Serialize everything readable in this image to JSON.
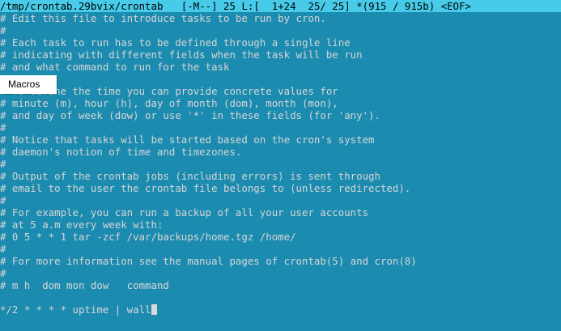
{
  "status_bar": {
    "file_path": "/tmp/crontab.29bvix/crontab",
    "mode": "[-M--]",
    "column": "25",
    "line_info": "L:[  1+24  25/ 25]",
    "byte_info": "*(915 / 915b)",
    "eof": "<EOF>"
  },
  "editor": {
    "lines": [
      "# Edit this file to introduce tasks to be run by cron.",
      "#",
      "# Each task to run has to be defined through a single line",
      "# indicating with different fields when the task will be run",
      "# and what command to run for the task",
      "#",
      "# To define the time you can provide concrete values for",
      "# minute (m), hour (h), day of month (dom), month (mon),",
      "# and day of week (dow) or use '*' in these fields (for 'any').",
      "#",
      "# Notice that tasks will be started based on the cron's system",
      "# daemon's notion of time and timezones.",
      "#",
      "# Output of the crontab jobs (including errors) is sent through",
      "# email to the user the crontab file belongs to (unless redirected).",
      "#",
      "# For example, you can run a backup of all your user accounts",
      "# at 5 a.m every week with:",
      "# 0 5 * * 1 tar -zcf /var/backups/home.tgz /home/",
      "#",
      "# For more information see the manual pages of crontab(5) and cron(8)",
      "#",
      "# m h  dom mon dow   command",
      "",
      "*/2 * * * * uptime | wall"
    ]
  },
  "popup": {
    "label": "Macros"
  }
}
